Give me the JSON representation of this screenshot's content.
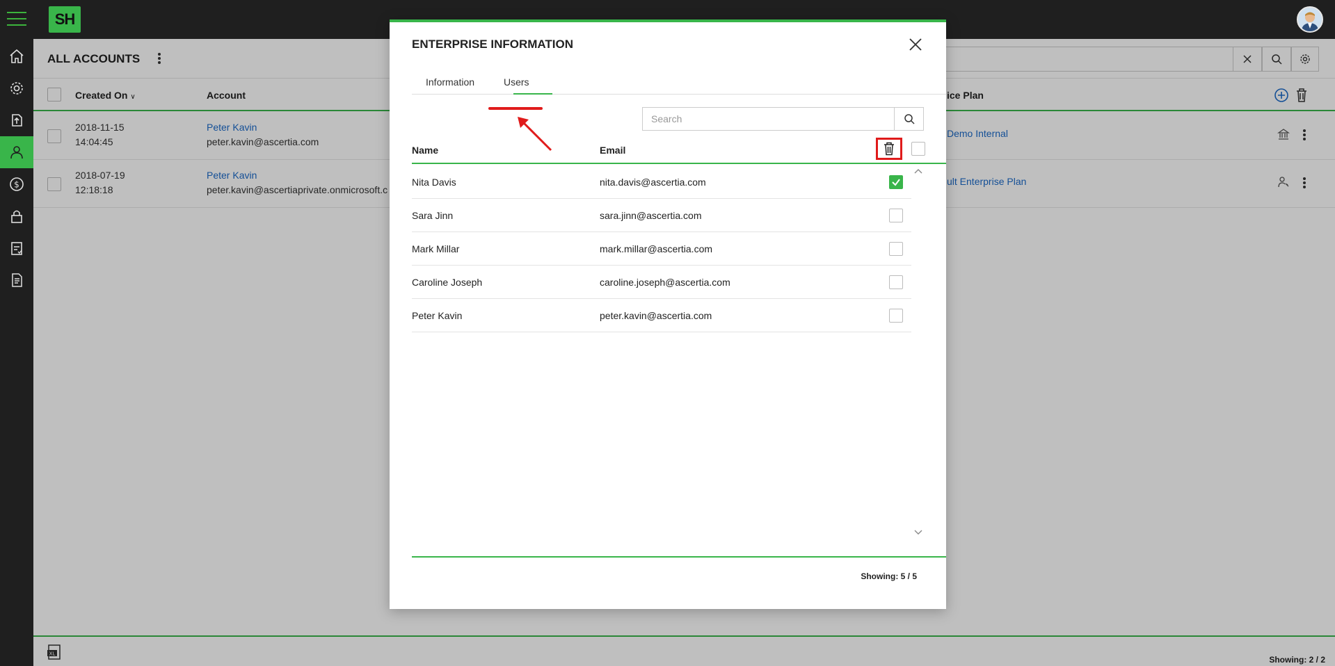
{
  "app": {
    "logo_text": "SH"
  },
  "sidebar": {
    "items": [
      {
        "icon": "home-icon"
      },
      {
        "icon": "gear-icon"
      },
      {
        "icon": "upload-icon"
      },
      {
        "icon": "user-icon",
        "active": true
      },
      {
        "icon": "dollar-icon"
      },
      {
        "icon": "lock-icon"
      },
      {
        "icon": "clipboard-icon"
      },
      {
        "icon": "document-icon"
      }
    ]
  },
  "page": {
    "title": "ALL ACCOUNTS",
    "columns": {
      "created_on": "Created On",
      "account": "Account",
      "service_plan": "ice Plan"
    },
    "rows": [
      {
        "date": "2018-11-15",
        "time": "14:04:45",
        "name": "Peter Kavin",
        "email": "peter.kavin@ascertia.com",
        "plan": "Demo Internal"
      },
      {
        "date": "2018-07-19",
        "time": "12:18:18",
        "name": "Peter Kavin",
        "email": "peter.kavin@ascertiaprivate.onmicrosoft.c",
        "plan": "ult Enterprise Plan"
      }
    ],
    "showing": "Showing: 2 / 2"
  },
  "modal": {
    "title": "ENTERPRISE INFORMATION",
    "tabs": [
      "Information",
      "Users"
    ],
    "active_tab": "Users",
    "search_placeholder": "Search",
    "columns": {
      "name": "Name",
      "email": "Email"
    },
    "users": [
      {
        "name": "Nita Davis",
        "email": "nita.davis@ascertia.com",
        "checked": true
      },
      {
        "name": "Sara Jinn",
        "email": "sara.jinn@ascertia.com",
        "checked": false
      },
      {
        "name": "Mark Millar",
        "email": "mark.millar@ascertia.com",
        "checked": false
      },
      {
        "name": "Caroline Joseph",
        "email": "caroline.joseph@ascertia.com",
        "checked": false
      },
      {
        "name": "Peter Kavin",
        "email": "peter.kavin@ascertia.com",
        "checked": false
      }
    ],
    "showing": "Showing: 5 / 5"
  },
  "colors": {
    "accent": "#39b54a",
    "topbar": "#1f1f1f",
    "link": "#1b6ac9",
    "highlight": "#e01b1b"
  }
}
